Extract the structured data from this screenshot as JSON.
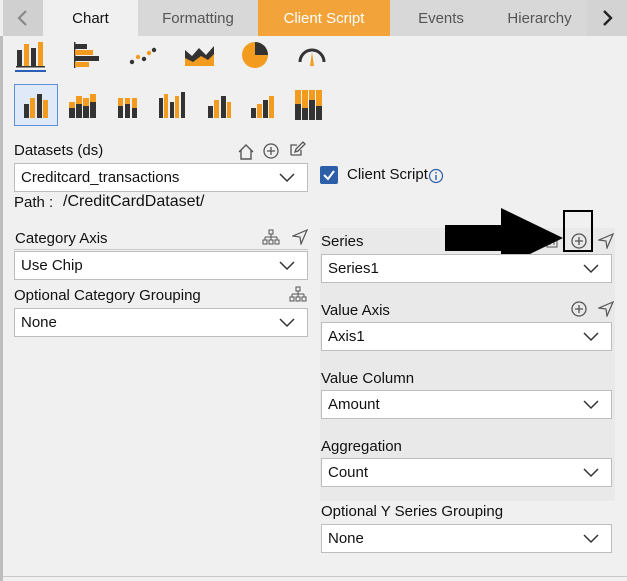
{
  "tabs": {
    "items": [
      "Chart",
      "Formatting",
      "Client Script",
      "Events",
      "Hierarchy"
    ]
  },
  "datasets": {
    "label": "Datasets (ds)",
    "value": "Creditcard_transactions",
    "path_label": "Path :",
    "path_value": "/CreditCardDataset/"
  },
  "client_script": {
    "label": "Client Script",
    "checked": true
  },
  "category_axis": {
    "label": "Category Axis",
    "value": "Use Chip"
  },
  "optional_category_grouping": {
    "label": "Optional Category Grouping",
    "value": "None"
  },
  "series": {
    "label": "Series",
    "value": "Series1"
  },
  "value_axis": {
    "label": "Value Axis",
    "value": "Axis1"
  },
  "value_column": {
    "label": "Value Column",
    "value": "Amount"
  },
  "aggregation": {
    "label": "Aggregation",
    "value": "Count"
  },
  "optional_y_series_grouping": {
    "label": "Optional Y Series Grouping",
    "value": "None"
  },
  "colors": {
    "accent": "#f2a33a",
    "checkbox": "#2c5fa8",
    "chart_icon": "#f29b1e"
  }
}
